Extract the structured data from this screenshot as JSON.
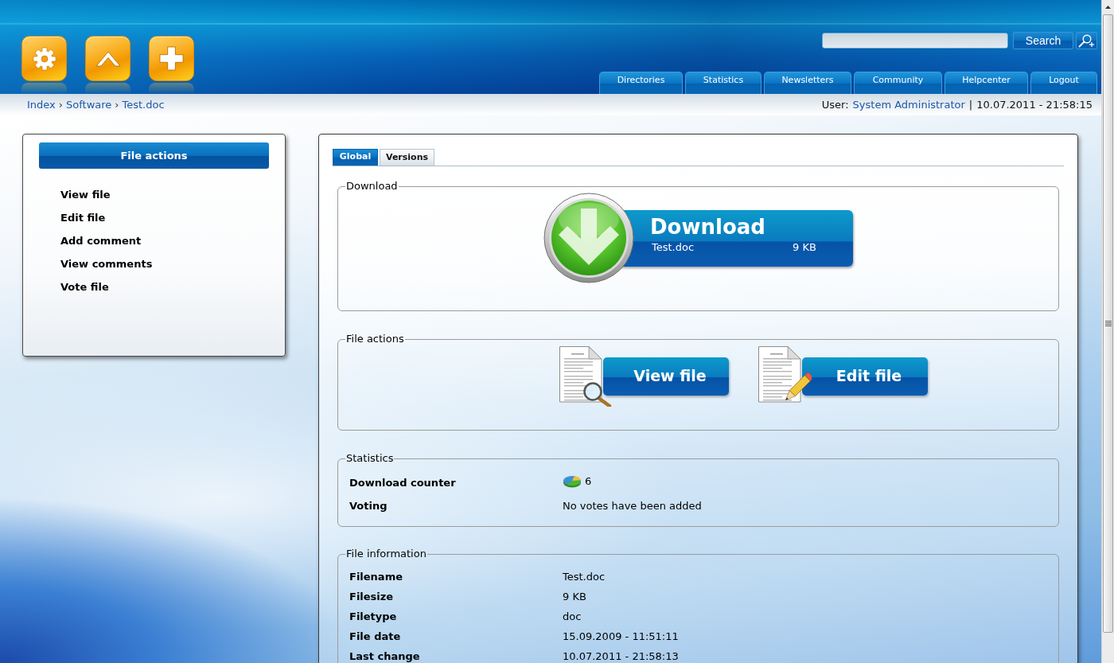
{
  "header": {
    "search": {
      "button": "Search"
    },
    "nav": [
      "Directories",
      "Statistics",
      "Newsletters",
      "Community",
      "Helpcenter",
      "Logout"
    ]
  },
  "breadcrumb": {
    "items": [
      "Index",
      "Software",
      "Test.doc"
    ],
    "separator": "›"
  },
  "user_info": {
    "label": "User:",
    "name": "System Administrator",
    "separator": "|",
    "datetime": "10.07.2011 - 21:58:15"
  },
  "sidebar": {
    "title": "File actions",
    "items": [
      "View file",
      "Edit file",
      "Add comment",
      "View comments",
      "Vote file"
    ]
  },
  "tabs": [
    {
      "label": "Global",
      "selected": true
    },
    {
      "label": "Versions",
      "selected": false
    }
  ],
  "download": {
    "legend": "Download",
    "button": {
      "label": "Download",
      "filename": "Test.doc",
      "size": "9 KB"
    }
  },
  "file_actions": {
    "legend": "File actions",
    "buttons": [
      {
        "kind": "view",
        "label": "View file"
      },
      {
        "kind": "edit",
        "label": "Edit file"
      }
    ]
  },
  "statistics": {
    "legend": "Statistics",
    "rows": [
      {
        "kind": "counter",
        "label": "Download counter",
        "value": "6"
      },
      {
        "kind": "text",
        "label": "Voting",
        "value": "No votes have been added"
      }
    ]
  },
  "file_information": {
    "legend": "File information",
    "rows": [
      {
        "label": "Filename",
        "value": "Test.doc"
      },
      {
        "label": "Filesize",
        "value": "9 KB"
      },
      {
        "label": "Filetype",
        "value": "doc"
      },
      {
        "label": "File date",
        "value": "15.09.2009 - 11:51:11"
      },
      {
        "label": "Last change",
        "value": "10.07.2011 - 21:58:13"
      }
    ]
  }
}
